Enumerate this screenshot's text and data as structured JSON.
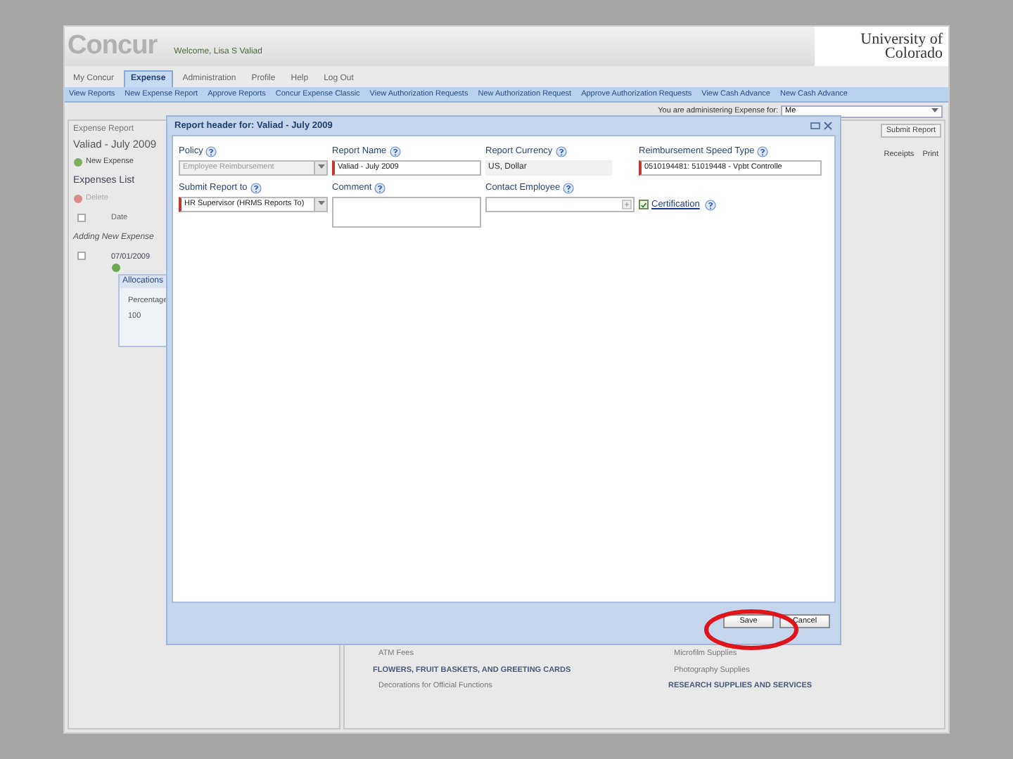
{
  "header": {
    "logo": "Concur",
    "welcome": "Welcome, Lisa S Valiad",
    "university": [
      "University of",
      "Colorado"
    ]
  },
  "tabs": [
    {
      "label": "My Concur",
      "selected": false
    },
    {
      "label": "Expense",
      "selected": true
    },
    {
      "label": "Administration",
      "selected": false
    },
    {
      "label": "Profile",
      "selected": false
    },
    {
      "label": "Help",
      "selected": false
    },
    {
      "label": "Log Out",
      "selected": false
    }
  ],
  "subnav": [
    "View Reports",
    "New Expense Report",
    "Approve Reports",
    "Concur Expense Classic",
    "View Authorization Requests",
    "New Authorization Request",
    "Approve Authorization Requests",
    "View Cash Advance",
    "New Cash Advance"
  ],
  "admin": {
    "label": "You are administering Expense for:",
    "value": "Me"
  },
  "report": {
    "caption": "Expense Report",
    "title": "Valiad - July 2009",
    "new_expense": "New Expense",
    "list_title": "Expenses List",
    "delete": "Delete",
    "select_all_checked": false,
    "date_column": "Date",
    "adding": "Adding New Expense",
    "row_checked": false,
    "row_date": "07/01/2009",
    "allocations": "Allocations",
    "percentage": "Percentage",
    "percent_value": "100"
  },
  "right_panel": {
    "actions": [
      "Submit Report"
    ],
    "tools": [
      "Receipts",
      "Print"
    ],
    "category_columns": [
      [
        {
          "text": "ATM Fees",
          "kind": "item"
        },
        {
          "text": "FLOWERS, FRUIT BASKETS, AND GREETING CARDS",
          "kind": "heading"
        },
        {
          "text": "Decorations for Official Functions",
          "kind": "item"
        }
      ],
      [
        {
          "text": "Microfilm Supplies",
          "kind": "item"
        },
        {
          "text": "Photography Supplies",
          "kind": "item"
        },
        {
          "text": "RESEARCH SUPPLIES AND SERVICES",
          "kind": "heading"
        }
      ]
    ]
  },
  "dialog": {
    "title": "Report header for: Valiad - July 2009",
    "fields": [
      {
        "label": "Policy",
        "kind": "select",
        "value": "Employee Reimbursement",
        "disabled": true,
        "required": false
      },
      {
        "label": "Report Name",
        "kind": "text",
        "value": "Valiad - July 2009",
        "disabled": false,
        "required": true
      },
      {
        "label": "Report Currency",
        "kind": "readonly",
        "value": "US, Dollar",
        "disabled": true,
        "required": false
      },
      {
        "label": "Reimbursement Speed Type",
        "kind": "text",
        "value": "0510194481: 51019448 - Vpbt Controlle",
        "disabled": false,
        "required": true
      },
      {
        "label": "Submit Report to",
        "kind": "select",
        "value": "HR Supervisor (HRMS Reports To)",
        "disabled": false,
        "required": true
      },
      {
        "label": "Comment",
        "kind": "textarea",
        "disabled": false,
        "required": false
      },
      {
        "label": "Contact Employee",
        "kind": "lookup",
        "disabled": false,
        "required": false
      },
      {
        "label": "Certification",
        "kind": "checkbox",
        "checked": true,
        "disabled": false,
        "required": false
      }
    ],
    "buttons": [
      "Save",
      "Cancel"
    ]
  }
}
